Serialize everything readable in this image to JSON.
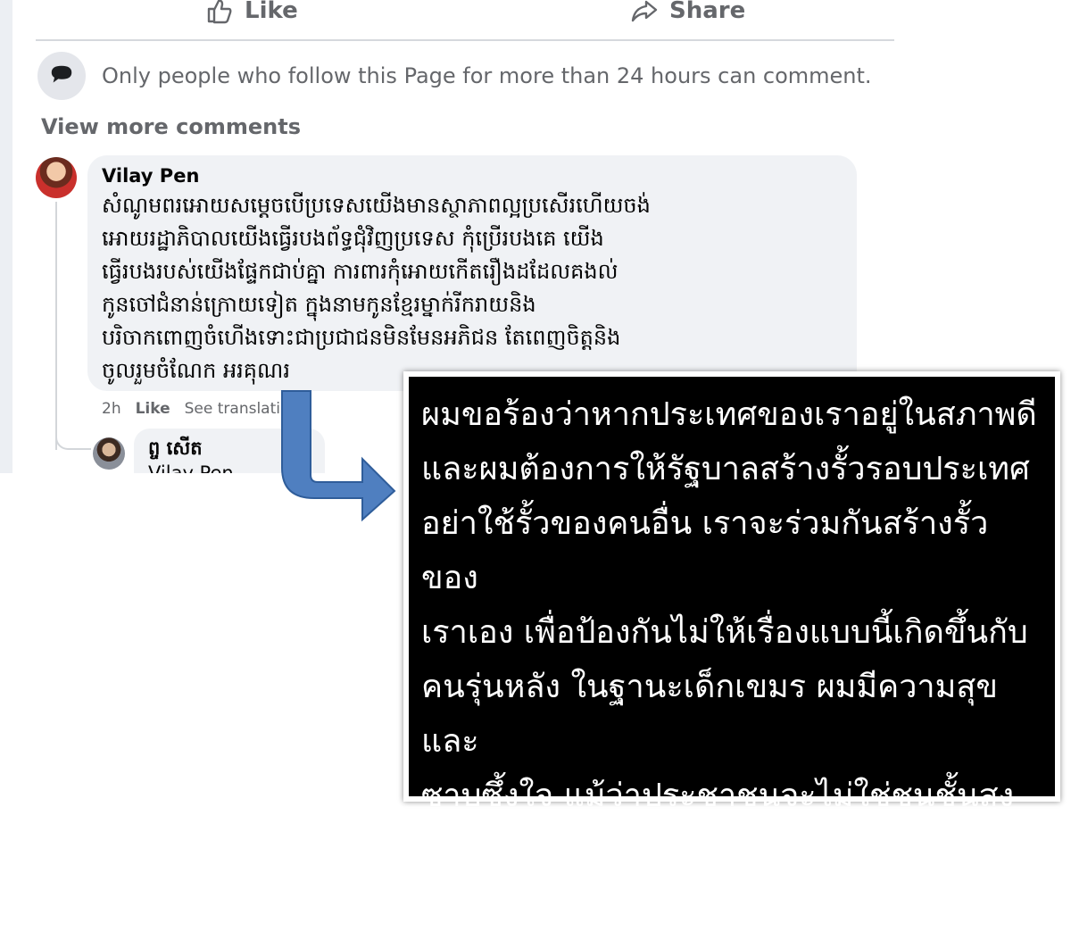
{
  "post_actions": {
    "like_label": "Like",
    "share_label": "Share"
  },
  "comment_notice": {
    "text": "Only people who follow this Page for more than 24 hours can comment."
  },
  "view_more_label": "View more comments",
  "comment": {
    "author": "Vilay Pen",
    "text": "សំណូមពរអោយសម្តេចបើប្រទេសយើងមានស្ថាភាពល្អប្រសើរហើយចង់\nអោយរដ្ឋាភិបាលយើងធ្វើរបងព័ទ្ធជុំវិញប្រទេស កុំប្រើរបងគេ យើង\nធ្វើរបងរបស់យើងផ្ទែកជាប់គ្នា ការពារកុំអោយកើតរឿងដដែលគងល់\nកូនចៅជំនាន់ក្រោយទៀត ក្នុងនាមកូនខ្មែរម្នាក់រីករាយនិង\nបរិចាកពោញចំហើងទោះជាប្រជាជនមិនមែនអភិជន តែពេញចិត្តនិង\nចូលរួមចំណែក អរគុណរ",
    "time": "2h",
    "like_label": "Like",
    "translate_label": "See translati"
  },
  "reply": {
    "author": "ព្ច សើត",
    "text": "Vilay Pen ..."
  },
  "translation": {
    "text": "ผมขอร้องว่าหากประเทศของเราอยู่ในสภาพดี\nและผมต้องการให้รัฐบาลสร้างรั้วรอบประเทศ\nอย่าใช้รั้วของคนอื่น เราจะร่วมกันสร้างรั้วของ\nเราเอง เพื่อป้องกันไม่ให้เรื่องแบบนี้เกิดขึ้นกับ\nคนรุ่นหลัง ในฐานะเด็กเขมร ผมมีความสุขและ\nซาบซึ้งใจ แม้ว่าประชาชนจะไม่ใช่ชนชั้นสูง แต่\nผมรู้สึกพอใจและมีส่วนร่วม ขอบคุณครับ"
  },
  "colors": {
    "secondary_text": "#65676b",
    "bubble_bg": "#f0f2f5",
    "arrow": "#4f7fc0",
    "translation_bg": "#000000"
  },
  "icons": {
    "like": "thumbs-up-icon",
    "share": "share-arrow-icon",
    "notice": "speech-bubble-icon",
    "callout": "bent-arrow-icon"
  }
}
